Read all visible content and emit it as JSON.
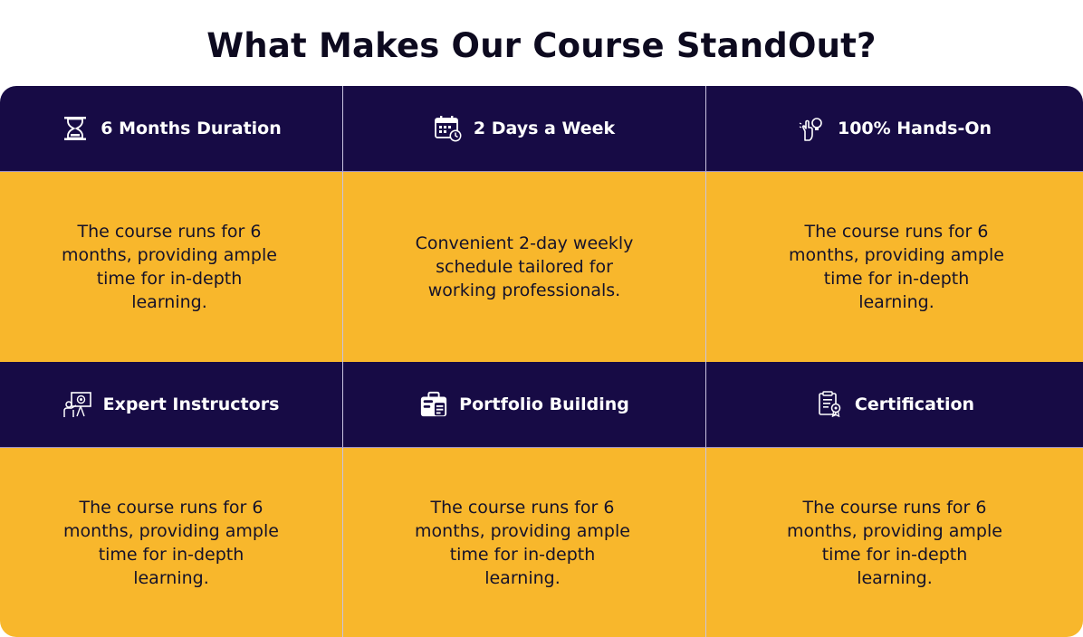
{
  "title": "What Makes Our Course StandOut?",
  "colors": {
    "header_bg": "#170b45",
    "body_bg": "#f8b72c",
    "title_text": "#0d0a1f",
    "header_text": "#ffffff"
  },
  "features": [
    {
      "heading": "6 Months Duration",
      "icon": "hourglass-icon",
      "description": "The course runs for 6 months, providing ample time for in-depth learning."
    },
    {
      "heading": "2 Days a Week",
      "icon": "calendar-clock-icon",
      "description": "Convenient 2-day weekly schedule tailored for working professionals."
    },
    {
      "heading": "100% Hands-On",
      "icon": "hand-bulb-icon",
      "description": "The course runs for 6 months, providing ample time for in-depth learning."
    },
    {
      "heading": "Expert Instructors",
      "icon": "instructor-presentation-icon",
      "description": "The course runs for 6 months, providing ample time for in-depth learning."
    },
    {
      "heading": "Portfolio Building",
      "icon": "portfolio-briefcase-icon",
      "description": "The course runs for 6 months, providing ample time for in-depth learning."
    },
    {
      "heading": "Certification",
      "icon": "certificate-icon",
      "description": "The course runs for 6 months, providing ample time for in-depth learning."
    }
  ]
}
